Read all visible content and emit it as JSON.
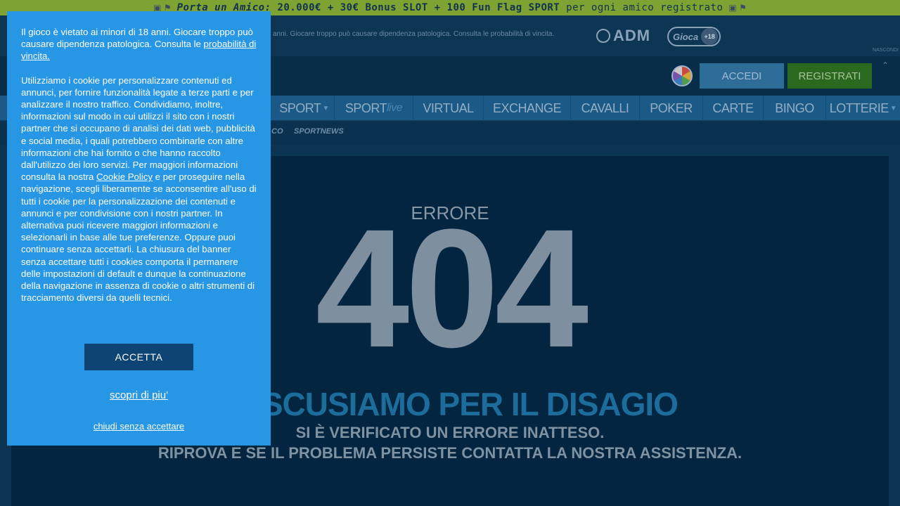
{
  "promo": {
    "prefix": "Porta un Amico:",
    "text": " 20.000€ + 30€ Bonus SLOT + 100 Fun Flag SPORT",
    "suffix": " per ogni amico registrato"
  },
  "infostrip": {
    "disclaimer": "anni. Giocare troppo può causare dipendenza patologica. Consulta le probabilità di vincita.",
    "adm_label": "ADM",
    "gioca_label": "Gioca",
    "age_badge": "+18",
    "hide_label": "NASCONDI"
  },
  "header": {
    "login_label": "ACCEDI",
    "register_label": "REGISTRATI"
  },
  "nav": {
    "items": [
      {
        "label": "SPORT",
        "dropdown": true
      },
      {
        "label": "SPORT",
        "suffix": "live"
      },
      {
        "label": "VIRTUAL"
      },
      {
        "label": "EXCHANGE"
      },
      {
        "label": "CAVALLI"
      },
      {
        "label": "POKER"
      },
      {
        "label": "CARTE"
      },
      {
        "label": "BINGO"
      },
      {
        "label": "LOTTERIE",
        "dropdown": true
      }
    ]
  },
  "subnav": {
    "items": [
      "CO",
      "SPORTNEWS"
    ]
  },
  "error": {
    "label": "ERRORE",
    "code": "404",
    "headline": "CI SCUSIAMO PER IL DISAGIO",
    "line1": "SI È VERIFICATO UN ERRORE INATTESO.",
    "line2": "RIPROVA E SE IL PROBLEMA PERSISTE CONTATTA LA NOSTRA ASSISTENZA."
  },
  "cookie": {
    "p1_text": "Il gioco è vietato ai minori di 18 anni. Giocare troppo può causare dipendenza patologica. Consulta le ",
    "p1_link": "probabilità di vincita.",
    "p2_text": "Utilizziamo i cookie per personalizzare contenuti ed annunci, per fornire funzionalità legate a terze parti e per analizzare il nostro traffico. Condividiamo, inoltre, informazioni sul modo in cui utilizzi il sito con i nostri partner che si occupano di analisi dei dati web, pubblicità e social media, i quali potrebbero combinarle con altre informazioni che hai fornito o che hanno raccolto dall'utilizzo dei loro servizi. Per maggiori informazioni consulta la nostra ",
    "p2_link": "Cookie Policy",
    "p2_text2": " e per proseguire nella navigazione, scegli liberamente se acconsentire all'uso di tutti i cookie per la personalizzazione dei contenuti e annunci e per condivisione con i nostri partner. In alternativa puoi ricevere maggiori informazioni e selezionarli in base alle tue preferenze. Oppure puoi continuare senza accettarli. La chiusura del banner senza accettare tutti i cookies comporta il permanere delle impostazioni di default e dunque la continuazione della navigazione in assenza di cookie o altri strumenti di tracciamento diversi da quelli tecnici.",
    "accept_label": "ACCETTA",
    "more_label": "scopri di piu'",
    "close_label": "chiudi senza accettare"
  }
}
